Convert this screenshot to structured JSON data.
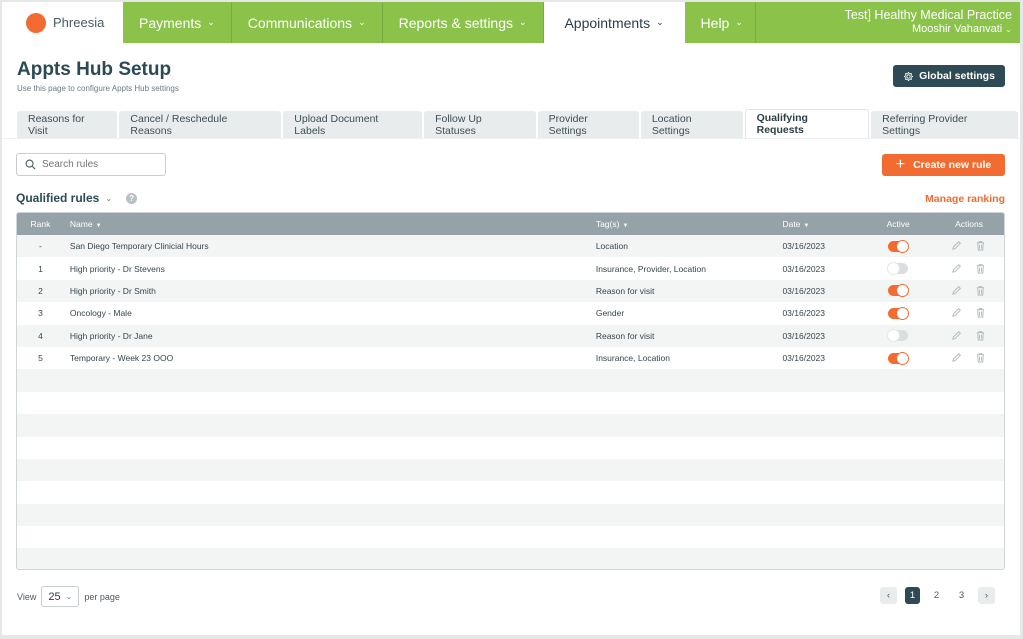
{
  "nav": {
    "logo_text": "Phreesia",
    "items": [
      {
        "label": "Payments",
        "active": false
      },
      {
        "label": "Communications",
        "active": false
      },
      {
        "label": "Reports & settings",
        "active": false
      },
      {
        "label": "Appointments",
        "active": true
      },
      {
        "label": "Help",
        "active": false
      }
    ],
    "practice": "Test] Healthy  Medical Practice",
    "user": "Mooshir  Vahanvati"
  },
  "header": {
    "title": "Appts Hub Setup",
    "subtitle": "Use this page to configure Appts Hub settings",
    "global_settings_label": "Global settings"
  },
  "tabs": [
    {
      "label": "Reasons for Visit",
      "active": false
    },
    {
      "label": "Cancel / Reschedule Reasons",
      "active": false
    },
    {
      "label": "Upload Document Labels",
      "active": false
    },
    {
      "label": "Follow Up Statuses",
      "active": false
    },
    {
      "label": "Provider Settings",
      "active": false
    },
    {
      "label": "Location Settings",
      "active": false
    },
    {
      "label": "Qualifying Requests",
      "active": true
    },
    {
      "label": "Referring Provider Settings",
      "active": false
    }
  ],
  "search": {
    "placeholder": "Search rules",
    "value": ""
  },
  "create_label": "Create new rule",
  "section": {
    "title": "Qualified rules",
    "manage_label": "Manage ranking"
  },
  "table": {
    "columns": {
      "rank": "Rank",
      "name": "Name",
      "tags": "Tag(s)",
      "date": "Date",
      "active": "Active",
      "actions": "Actions"
    },
    "rows": [
      {
        "rank": "-",
        "name": "San Diego Temporary Clinicial Hours",
        "tags": "Location",
        "date": "03/16/2023",
        "active": true
      },
      {
        "rank": "1",
        "name": "High priority - Dr Stevens",
        "tags": "Insurance, Provider, Location",
        "date": "03/16/2023",
        "active": false
      },
      {
        "rank": "2",
        "name": "High priority - Dr Smith",
        "tags": "Reason for visit",
        "date": "03/16/2023",
        "active": true
      },
      {
        "rank": "3",
        "name": "Oncology - Male",
        "tags": "Gender",
        "date": "03/16/2023",
        "active": true
      },
      {
        "rank": "4",
        "name": "High priority - Dr Jane",
        "tags": "Reason for visit",
        "date": "03/16/2023",
        "active": false
      },
      {
        "rank": "5",
        "name": "Temporary - Week 23 OOO",
        "tags": "Insurance, Location",
        "date": "03/16/2023",
        "active": true
      }
    ],
    "empty_rows": 9
  },
  "footer": {
    "view_label": "View",
    "per_page_value": "25",
    "per_page_label": "per page",
    "pages": [
      "1",
      "2",
      "3"
    ],
    "current_page": "1"
  },
  "colors": {
    "brand_green": "#8bc34a",
    "accent_orange": "#f26b30",
    "dark_teal": "#2e4b55"
  }
}
